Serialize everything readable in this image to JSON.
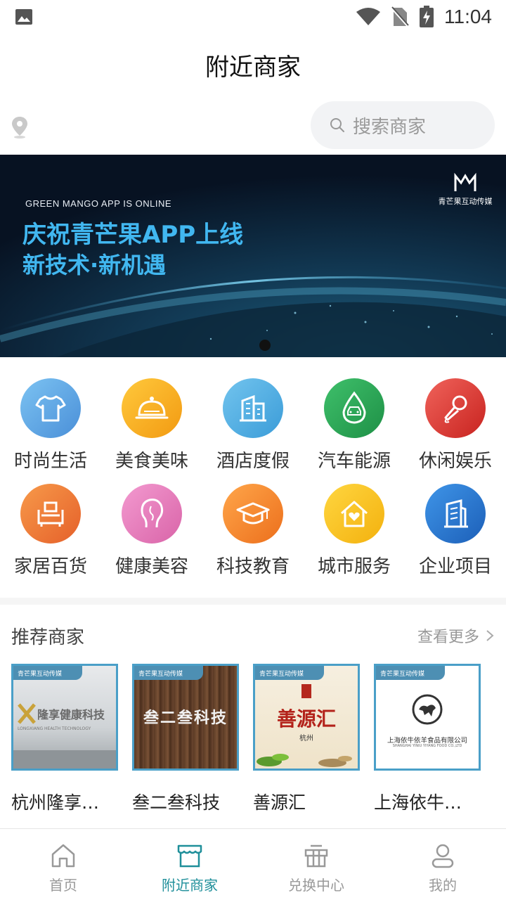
{
  "status_bar": {
    "time": "11:04"
  },
  "header": {
    "title": "附近商家"
  },
  "search": {
    "placeholder": "搜索商家"
  },
  "banner": {
    "tag": "GREEN MANGO APP IS ONLINE",
    "title": "庆祝青芒果APP上线",
    "subtitle": "新技术·新机遇",
    "logo_text": "青芒果互动传媒",
    "page_count": 1,
    "current_page": 1
  },
  "categories": [
    {
      "label": "时尚生活",
      "icon": "tshirt-icon",
      "color": "#5aa9e6"
    },
    {
      "label": "美食美味",
      "icon": "food-cloche-icon",
      "color": "#f5b320"
    },
    {
      "label": "酒店度假",
      "icon": "building-icon",
      "color": "#4fb0e0"
    },
    {
      "label": "汽车能源",
      "icon": "car-drop-icon",
      "color": "#2daa56"
    },
    {
      "label": "休闲娱乐",
      "icon": "microphone-icon",
      "color": "#e03a35"
    },
    {
      "label": "家居百货",
      "icon": "furniture-icon",
      "color": "#f07a2e"
    },
    {
      "label": "健康美容",
      "icon": "face-icon",
      "color": "#e879b8"
    },
    {
      "label": "科技教育",
      "icon": "graduation-cap-icon",
      "color": "#f38a2b"
    },
    {
      "label": "城市服务",
      "icon": "house-heart-icon",
      "color": "#f7c21b"
    },
    {
      "label": "企业项目",
      "icon": "office-building-icon",
      "color": "#2f7fd6"
    }
  ],
  "recommended": {
    "title": "推荐商家",
    "more_label": "查看更多",
    "brand_tag": "青芒果互动传媒",
    "merchants": [
      {
        "name": "杭州隆享…",
        "image_text": "隆享健康科技",
        "image_subtext": "LONGXIANG HEALTH TECHNOLOGY"
      },
      {
        "name": "叁二叁科技",
        "image_text": "叁二叁科技"
      },
      {
        "name": "善源汇",
        "image_text": "善源汇",
        "image_subtext": "杭州"
      },
      {
        "name": "上海依牛…",
        "image_text": "上海依牛依羊食品有限公司",
        "image_subtext": "SHANGHAI YINIU YIYANG FOOD CO.,LTD"
      }
    ]
  },
  "tabbar": {
    "items": [
      {
        "label": "首页",
        "icon": "home-icon",
        "active": false
      },
      {
        "label": "附近商家",
        "icon": "store-icon",
        "active": true
      },
      {
        "label": "兑换中心",
        "icon": "gift-icon",
        "active": false
      },
      {
        "label": "我的",
        "icon": "user-icon",
        "active": false
      }
    ]
  },
  "colors": {
    "accent": "#1f8f9a",
    "banner_text": "#41b7f0"
  }
}
